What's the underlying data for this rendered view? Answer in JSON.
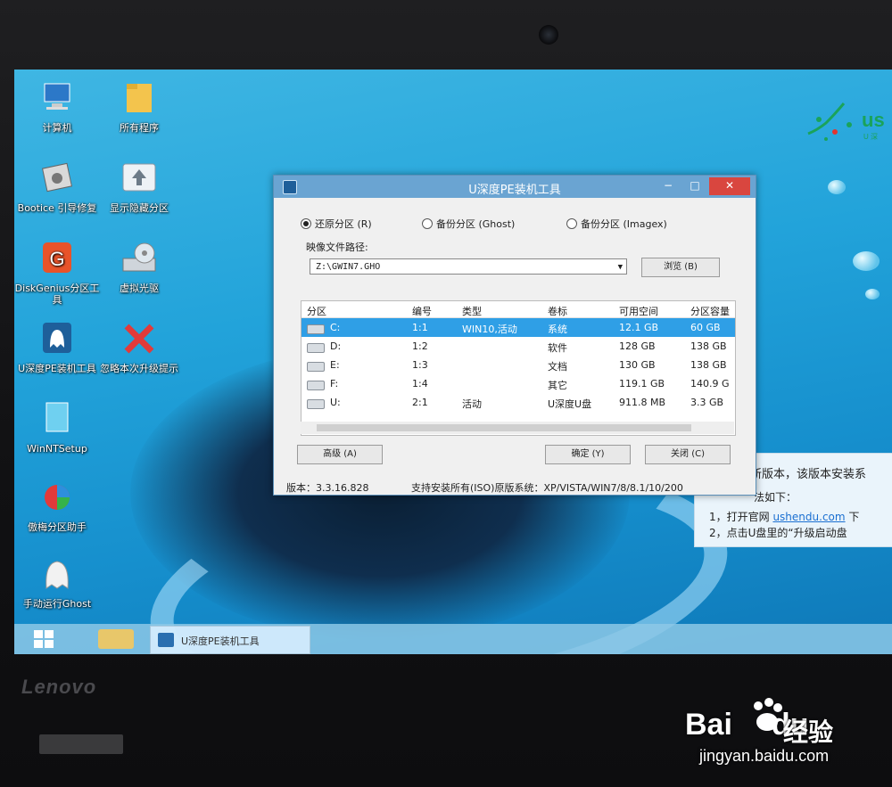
{
  "desktop": {
    "icons": [
      {
        "label": "计算机",
        "icon": "computer-icon"
      },
      {
        "label": "所有程序",
        "icon": "folder-icon"
      },
      {
        "label": "Bootice 引导修复",
        "icon": "disk-icon"
      },
      {
        "label": "显示隐藏分区",
        "icon": "partition-icon"
      },
      {
        "label": "DiskGenius分区工具",
        "icon": "diskgenius-icon"
      },
      {
        "label": "虚拟光驱",
        "icon": "virtual-drive-icon"
      },
      {
        "label": "U深度PE装机工具",
        "icon": "usd-ghost-icon"
      },
      {
        "label": "忽略本次升级提示",
        "icon": "red-x-icon"
      },
      {
        "label": "WinNTSetup",
        "icon": "winntsetup-icon"
      },
      {
        "label": "傲梅分区助手",
        "icon": "aomei-icon"
      },
      {
        "label": "手动运行Ghost",
        "icon": "ghost-icon"
      }
    ],
    "logo": {
      "text": "us",
      "sub": "U 深"
    }
  },
  "dialog": {
    "title": "U深度PE装机工具",
    "controls": {
      "minimize": "−",
      "maximize": "□",
      "close": "✕"
    },
    "radio": [
      {
        "label": "还原分区 (R)",
        "checked": true
      },
      {
        "label": "备份分区 (Ghost)",
        "checked": false
      },
      {
        "label": "备份分区 (Imagex)",
        "checked": false
      }
    ],
    "path_label": "映像文件路径:",
    "path_value": "Z:\\GWIN7.GHO",
    "browse_label": "浏览 (B)",
    "columns": [
      "分区",
      "编号",
      "类型",
      "卷标",
      "可用空间",
      "分区容量"
    ],
    "rows": [
      {
        "part": "C:",
        "num": "1:1",
        "type": "WIN10,活动",
        "label": "系统",
        "free": "12.1 GB",
        "cap": "60 GB",
        "selected": true
      },
      {
        "part": "D:",
        "num": "1:2",
        "type": "",
        "label": "软件",
        "free": "128 GB",
        "cap": "138 GB",
        "selected": false
      },
      {
        "part": "E:",
        "num": "1:3",
        "type": "",
        "label": "文档",
        "free": "130 GB",
        "cap": "138 GB",
        "selected": false
      },
      {
        "part": "F:",
        "num": "1:4",
        "type": "",
        "label": "其它",
        "free": "119.1 GB",
        "cap": "140.9 G",
        "selected": false
      },
      {
        "part": "U:",
        "num": "2:1",
        "type": "活动",
        "label": "U深度U盘",
        "free": "911.8 MB",
        "cap": "3.3 GB",
        "selected": false
      }
    ],
    "advanced_label": "高级 (A)",
    "ok_label": "确定 (Y)",
    "close_label": "关闭 (C)",
    "version": "版本：3.3.16.828",
    "support": "支持安装所有(ISO)原版系统：XP/VISTA/WIN7/8/8.1/10/200"
  },
  "info_panel": {
    "line1": "新版本，该版本安装系",
    "line2": "法如下：",
    "line3_prefix": "1，打开官网 ",
    "line3_link": "ushendu.com",
    "line3_suffix": " 下",
    "line4": "2，点击U盘里的“升级启动盘"
  },
  "taskbar": {
    "task_label": "U深度PE装机工具"
  },
  "watermark": {
    "brand": "Lenovo",
    "baidu": "Bai",
    "baidu2": "du",
    "baidu_cn": "经验",
    "url": "jingyan.baidu.com"
  }
}
